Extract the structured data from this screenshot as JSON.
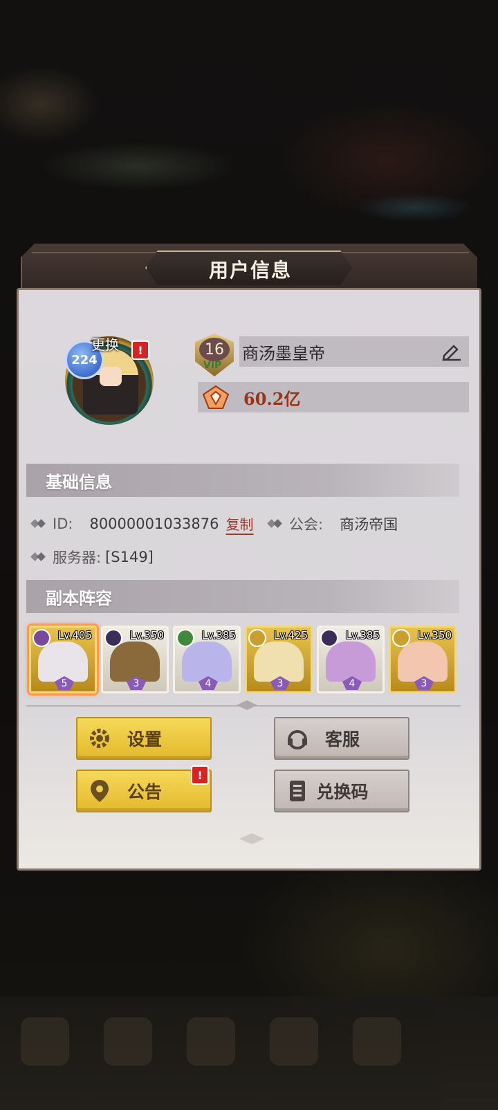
{
  "dialog": {
    "title": "用户信息"
  },
  "profile": {
    "avatar_level": "224",
    "change_label": "更换",
    "alert_mark": "!",
    "vip_level": "16",
    "vip_label": "VIP",
    "nickname": "商汤墨皇帝",
    "power": "60.2亿"
  },
  "basic_info": {
    "header": "基础信息",
    "id_label": "ID:",
    "id_value": "80000001033876",
    "copy_label": "复制",
    "guild_label": "公会:",
    "guild_value": "商汤帝国",
    "server_label": "服务器:",
    "server_value": "[S149]"
  },
  "lineup": {
    "header": "副本阵容",
    "heroes": [
      {
        "level": "Lv.405",
        "stars": "5",
        "frame": "gold",
        "element": "#7a4a9a",
        "art": "#e8e4ea",
        "selected": true
      },
      {
        "level": "Lv.350",
        "stars": "3",
        "frame": "silver",
        "element": "#3a2d5a",
        "art": "#8a6a3a",
        "selected": false
      },
      {
        "level": "Lv.385",
        "stars": "4",
        "frame": "silver",
        "element": "#3f8a3a",
        "art": "#b9b4ea",
        "selected": false
      },
      {
        "level": "Lv.425",
        "stars": "3",
        "frame": "gold",
        "element": "#c9a030",
        "art": "#f0e0b0",
        "selected": false
      },
      {
        "level": "Lv.385",
        "stars": "4",
        "frame": "silver",
        "element": "#3a2d5a",
        "art": "#c79ad8",
        "selected": false
      },
      {
        "level": "Lv.350",
        "stars": "3",
        "frame": "gold",
        "element": "#c9a030",
        "art": "#f3c6b0",
        "selected": false
      }
    ]
  },
  "buttons": {
    "settings": "设置",
    "support": "客服",
    "notice": "公告",
    "redeem": "兑换码"
  },
  "colors": {
    "accent_yellow": "#f2d04c",
    "power_text": "#9a3418",
    "copy_link": "#9a3a2a",
    "alert_red": "#d62424"
  }
}
